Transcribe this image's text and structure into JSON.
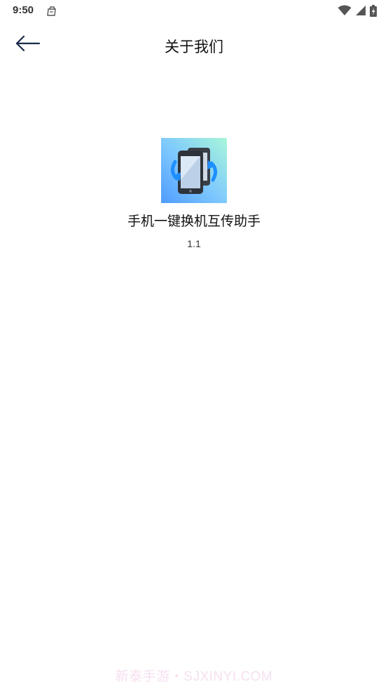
{
  "status_bar": {
    "time": "9:50",
    "icons": [
      "notification-bag-icon",
      "wifi-icon",
      "signal-icon",
      "battery-charging-icon"
    ]
  },
  "header": {
    "title": "关于我们",
    "back_icon": "arrow-left-icon"
  },
  "about": {
    "app_name": "手机一键换机互传助手",
    "version": "1.1",
    "logo_icon": "phone-transfer-icon"
  },
  "watermark": "新泰手游・SJXINYI.COM",
  "colors": {
    "background": "#ffffff",
    "text": "#111111",
    "back_arrow": "#1b2a4a",
    "logo_gradient_start": "#9ff5d8",
    "logo_gradient_end": "#5aa8ff",
    "arrow_accent": "#1f8fff",
    "watermark": "#f6dff0"
  }
}
